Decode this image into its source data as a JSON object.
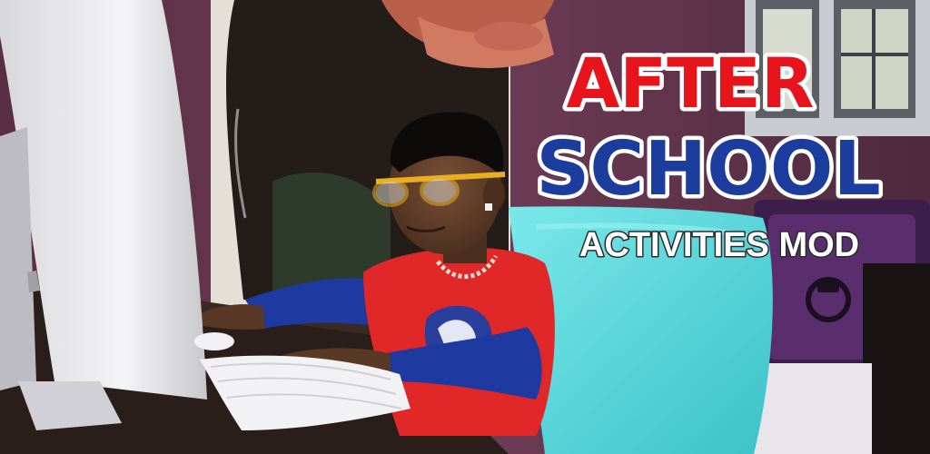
{
  "title": {
    "line1": "AFTER",
    "line2": "SCHOOL",
    "subtitle": "ACTIVITIES MOD"
  },
  "colors": {
    "line1_fill": "#e8141c",
    "line2_fill": "#1c3c9e",
    "outline": "#ffffff",
    "subtitle_fill": "#ffffff",
    "subtitle_outline": "#2a2a2a",
    "wall": "#6a3a52",
    "desk": "#2a1e1a",
    "shirt": "#e02828",
    "sleeve": "#1e3aa0",
    "chair": "#5ad8d8"
  }
}
